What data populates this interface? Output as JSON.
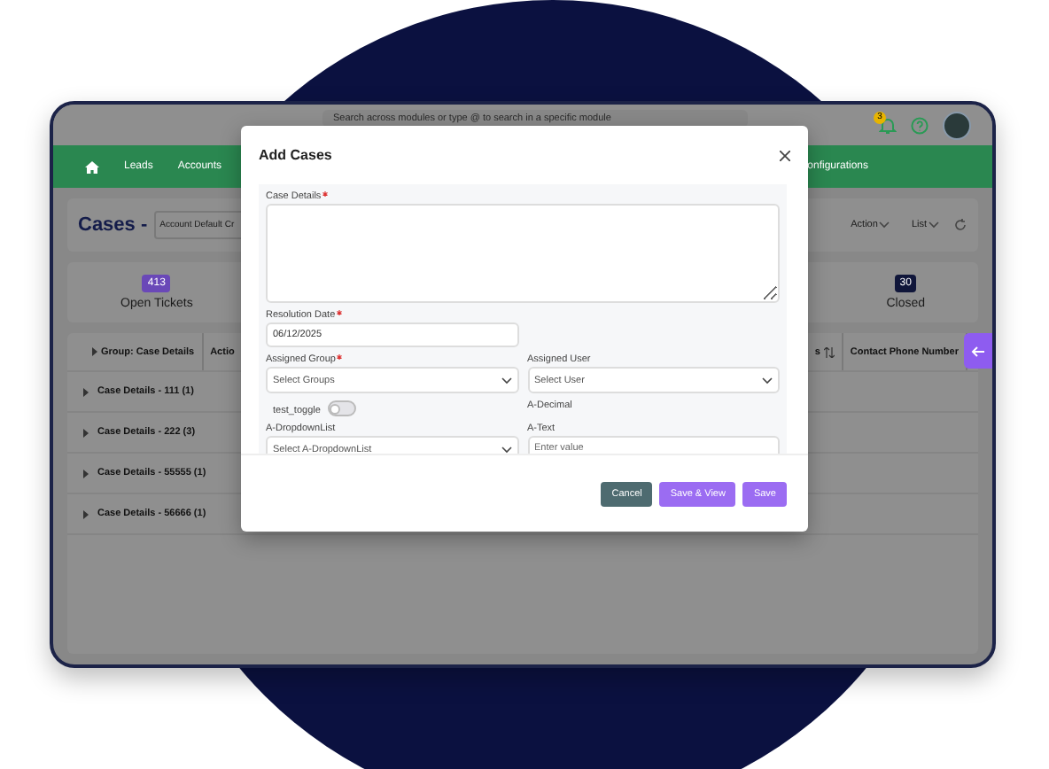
{
  "topbar": {
    "search": {
      "placeholder": "Search across modules or type @ to search in a specific module"
    },
    "notifications": {
      "badge": "3"
    }
  },
  "nav": {
    "left": [
      "Leads",
      "Accounts"
    ],
    "right": [
      "onfigurations"
    ]
  },
  "header": {
    "title": "Cases -",
    "view": "Account Default Cr",
    "actions": [
      "Action",
      "List"
    ]
  },
  "stats": [
    {
      "count": "413",
      "label": "Open Tickets",
      "color": "#6a48b8"
    },
    {
      "count": "30",
      "label": "Closed",
      "color": "#10163a"
    }
  ],
  "table": {
    "columns_left": [
      "Group: Case Details",
      "Actio"
    ],
    "columns_right": [
      "s",
      "Contact Phone Number"
    ],
    "groups": [
      {
        "label": "Case Details - 111 (1)",
        "expanded": false
      },
      {
        "label": "Case Details - 222 (3)",
        "expanded": false
      },
      {
        "label": "Case Details - 55555 (1)",
        "expanded": false
      },
      {
        "label": "Case Details - 56666 (1)",
        "expanded": false
      }
    ]
  },
  "modal": {
    "title": "Add Cases",
    "rows": [
      [
        {
          "kind": "textarea",
          "label": "Case Details",
          "required": true
        }
      ],
      [
        {
          "kind": "input",
          "label": "Resolution Date",
          "required": true,
          "value": "06/12/2025"
        }
      ],
      [
        {
          "kind": "select",
          "label": "Assigned Group",
          "required": true,
          "placeholder": "Select Groups"
        },
        {
          "kind": "select",
          "label": "Assigned User",
          "required": false,
          "placeholder": "Select User"
        }
      ],
      [
        {
          "kind": "toggle",
          "label": "test_toggle",
          "required": false,
          "on": false
        },
        {
          "kind": "label",
          "label": "A-Decimal",
          "required": false
        }
      ],
      [
        {
          "kind": "select",
          "label": "A-DropdownList",
          "required": false,
          "placeholder": "Select A-DropdownList"
        },
        {
          "kind": "input",
          "label": "A-Text",
          "required": false,
          "placeholder": "Enter value"
        }
      ]
    ],
    "buttons": [
      {
        "label": "Cancel",
        "kind": "secondary"
      },
      {
        "label": "Save & View",
        "kind": "primary"
      },
      {
        "label": "Save",
        "kind": "primary"
      }
    ]
  }
}
